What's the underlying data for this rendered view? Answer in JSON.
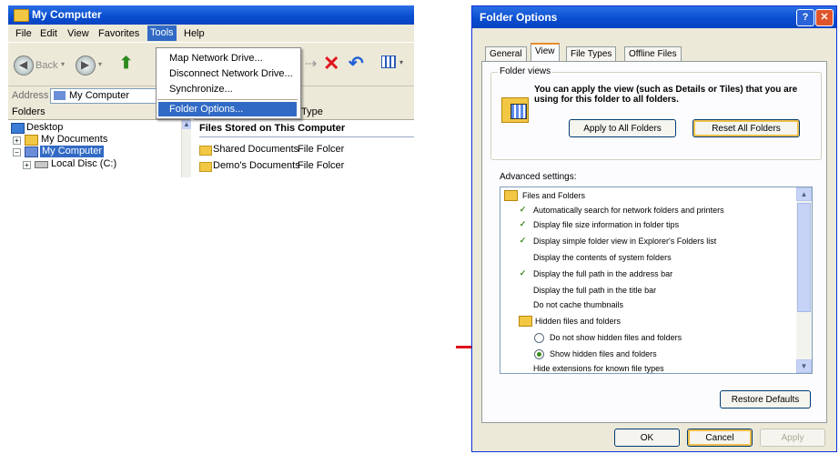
{
  "my_computer": {
    "title": "My Computer",
    "menu": [
      "File",
      "Edit",
      "View",
      "Favorites",
      "Tools",
      "Help"
    ],
    "toolbar": {
      "back_label": "Back"
    },
    "address": {
      "label": "Address",
      "value": "My Computer"
    },
    "folders_pane": {
      "header": "Folders",
      "items": [
        "Desktop",
        "My Documents",
        "My Computer",
        "Local Disc (C:)"
      ]
    },
    "column_type": "Type",
    "group_title": "Files Stored on This Computer",
    "files": [
      {
        "name": "Shared Documents",
        "type": "File Folcer"
      },
      {
        "name": "Demo's Documents",
        "type": "File Folcer"
      }
    ],
    "tools_menu": [
      "Map Network Drive...",
      "Disconnect Network Drive...",
      "Synchronize...",
      "Folder Options..."
    ]
  },
  "folder_options": {
    "title": "Folder Options",
    "title_buttons": {
      "help": "?",
      "close": "✕"
    },
    "tabs": [
      "General",
      "View",
      "File Types",
      "Offline Files"
    ],
    "selected_tab": "View",
    "folder_views": {
      "label": "Folder views",
      "description": "You can apply the view (such as Details or Tiles) that you are using for this folder to all folders.",
      "apply_button": "Apply to All Folders",
      "reset_button": "Reset All Folders"
    },
    "advanced_label": "Advanced settings:",
    "advanced_items": [
      {
        "kind": "folder",
        "indent": 0,
        "label": "Files and Folders"
      },
      {
        "kind": "check",
        "checked": true,
        "label": "Automatically search for network folders and printers"
      },
      {
        "kind": "check",
        "checked": true,
        "label": "Display file size information in folder tips"
      },
      {
        "kind": "check",
        "checked": true,
        "label": "Display simple folder view in Explorer's Folders list"
      },
      {
        "kind": "check",
        "checked": false,
        "label": "Display the contents of system folders"
      },
      {
        "kind": "check",
        "checked": true,
        "label": "Display the full path in the address bar"
      },
      {
        "kind": "check",
        "checked": false,
        "label": "Display the full path in the title bar"
      },
      {
        "kind": "check",
        "checked": false,
        "label": "Do not cache thumbnails"
      },
      {
        "kind": "folder",
        "indent": 1,
        "label": "Hidden files and folders"
      },
      {
        "kind": "radio",
        "checked": false,
        "label": "Do not show hidden files and folders"
      },
      {
        "kind": "radio",
        "checked": true,
        "label": "Show hidden files and folders"
      },
      {
        "kind": "check",
        "checked": false,
        "label": "Hide extensions for known file types"
      }
    ],
    "restore_button": "Restore Defaults",
    "ok_button": "OK",
    "cancel_button": "Cancel",
    "apply_button": "Apply"
  },
  "colors": {
    "accent": "#316ac5",
    "arrow": "#e0141c",
    "titlebar": "#0a4fd0"
  }
}
